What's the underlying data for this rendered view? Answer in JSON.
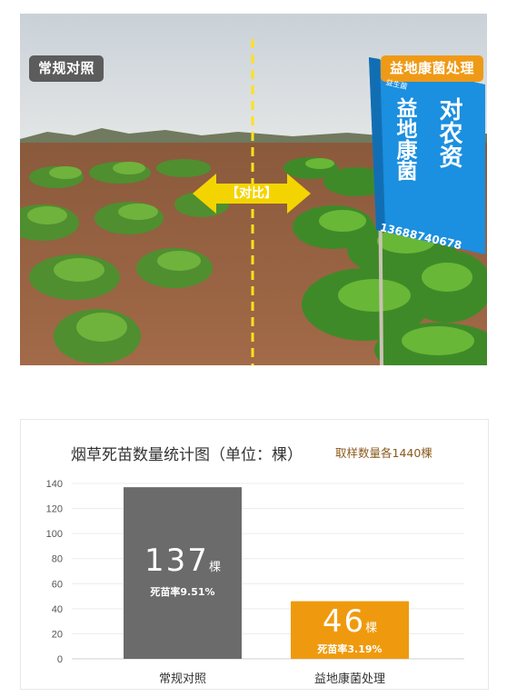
{
  "photo": {
    "left_tag": "常规对照",
    "right_tag": "益地康菌处理",
    "compare_label": "【对比】",
    "flag_main": "益地康菌",
    "flag_side": "对农资",
    "flag_phone": "13688740678",
    "flag_small": "益生菌"
  },
  "chart_data": {
    "type": "bar",
    "title": "烟草死苗数量统计图（单位：棵）",
    "note": "取样数量各1440棵",
    "categories": [
      "常规对照",
      "益地康菌处理"
    ],
    "values": [
      137,
      46
    ],
    "unit": "棵",
    "rates": [
      "死苗率9.51%",
      "死苗率3.19%"
    ],
    "ylim": [
      0,
      140
    ],
    "yticks": [
      0,
      20,
      40,
      60,
      80,
      100,
      120,
      140
    ],
    "colors": [
      "#6b6b6b",
      "#ef9a0e"
    ],
    "grid": true
  }
}
